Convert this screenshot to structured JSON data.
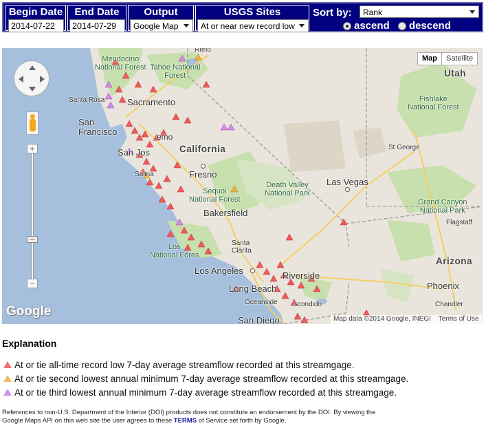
{
  "form": {
    "begin_date": {
      "label": "Begin Date",
      "value": "2014-07-22"
    },
    "end_date": {
      "label": "End Date",
      "value": "2014-07-29"
    },
    "output": {
      "label": "Output",
      "value": "Google Map"
    },
    "sites": {
      "label": "USGS Sites",
      "value": "At or near new record low"
    },
    "sort": {
      "label": "Sort by:",
      "value": "Rank",
      "ascend": "ascend",
      "descend": "descend",
      "selected": "ascend"
    }
  },
  "map": {
    "type_buttons": {
      "map": "Map",
      "satellite": "Satellite"
    },
    "zoom_in": "+",
    "zoom_out": "−",
    "attribution": "Map data ©2014 Google, INEGI",
    "terms": "Terms of Use",
    "logo": "Google",
    "labels": {
      "reno": "Reno",
      "mendocino": "Mendocino\nNational Forest",
      "tahoe": "Tahoe National\nForest",
      "santa_rosa": "Santa Rosa",
      "sacramento": "Sacramento",
      "san_francisco": "San\nFrancisco",
      "san_jose": "San Jos",
      "fremont": "emo",
      "salinas": "Salina",
      "california": "California",
      "fresno": "Fresno",
      "sequoia": "Sequoi\nNational Forest",
      "bakersfield": "Bakersfield",
      "los_padres": "Los\nNational Fores",
      "santa_clarita": "Santa\nClarita",
      "los_angeles": "Los Angeles",
      "long_beach": "Long Beach",
      "riverside": "Riverside",
      "oceanside": "Oceanside",
      "escondido": "scondido",
      "san_diego": "San Diego",
      "death_valley": "Death Valley\nNational Park",
      "las_vegas": "Las Vegas",
      "utah": "Utah",
      "fishlake": "Fishlake\nNational Forest",
      "st_george": "St George",
      "grand_canyon": "Grand Canyon\nNational Park",
      "flagstaff": "Flagstaff",
      "arizona": "Arizona",
      "phoenix": "Phoenix",
      "chandler": "Chandler"
    }
  },
  "legend_colors": {
    "record_low": "#f05a5a",
    "second_lowest": "#f0b040",
    "third_lowest": "#d888e8"
  },
  "explanation": {
    "title": "Explanation",
    "items": [
      {
        "color": "#f07070",
        "text": "At or tie all-time record low 7-day average streamflow recorded at this streamgage."
      },
      {
        "color": "#f0b860",
        "text": "At or tie second lowest annual minimum 7-day average streamflow recorded at this streamgage."
      },
      {
        "color": "#d090e8",
        "text": "At or tie third lowest annual minimum 7-day average streamflow recorded at this streamgage."
      }
    ]
  },
  "footer": {
    "text_1": "References to non-U.S. Department of the Interior (DOI) products does not constitute an endorsement by the DOI. By viewing the",
    "text_2": "Google Maps API on this web site the user agrees to these",
    "terms_link": "TERMS",
    "text_3": "of Service set forth by Google."
  }
}
